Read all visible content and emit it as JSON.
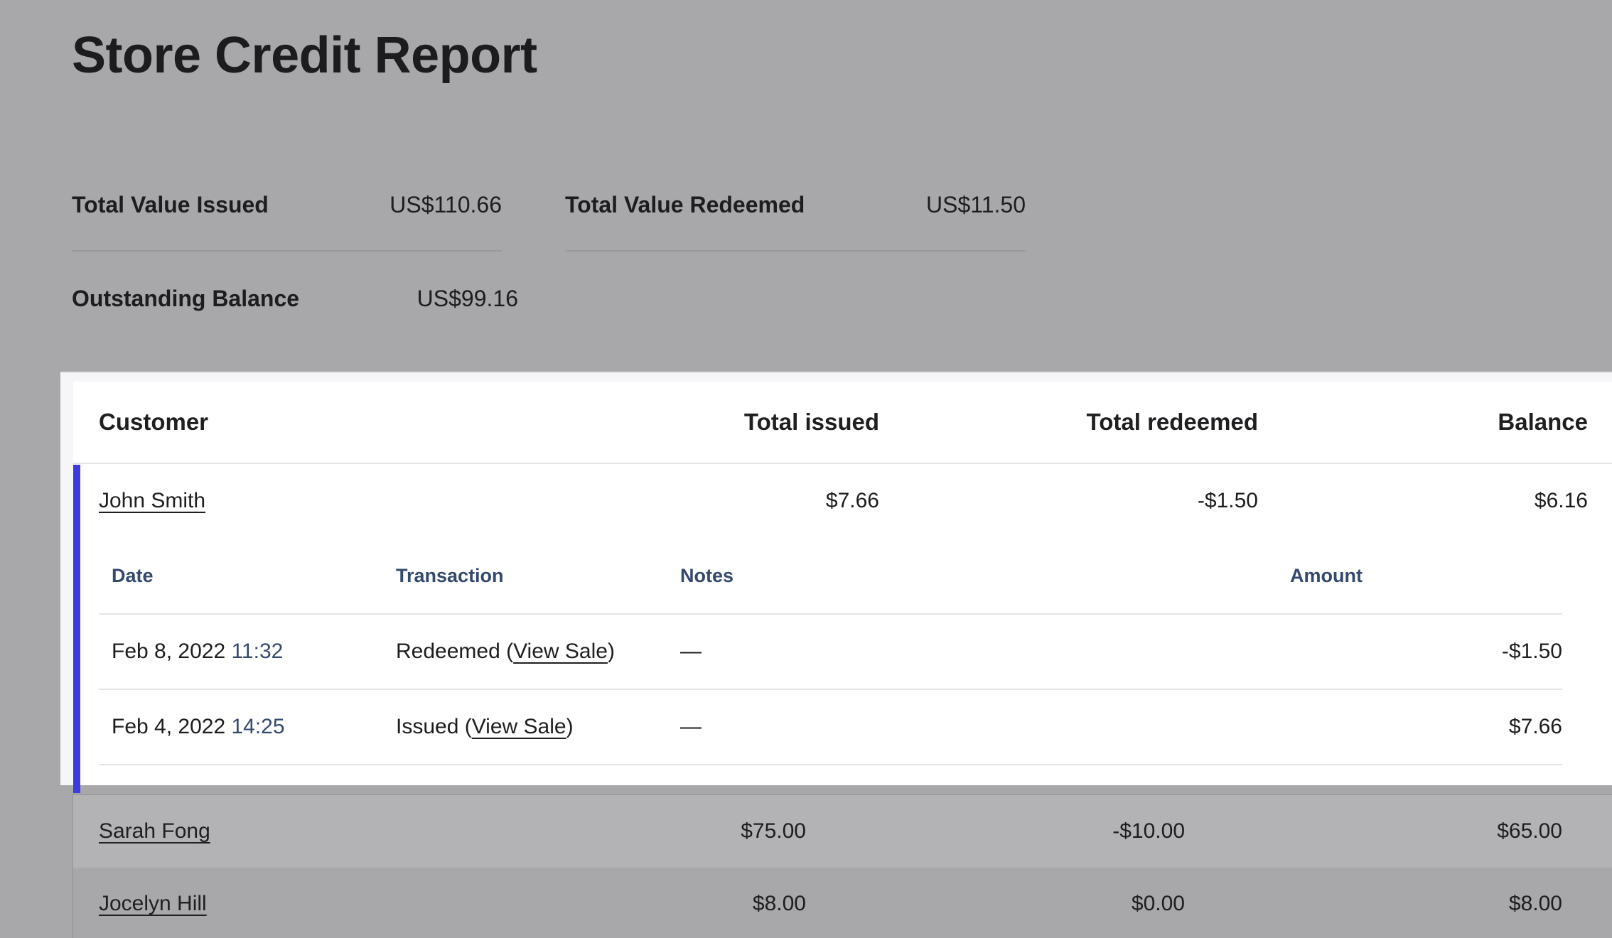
{
  "page": {
    "title": "Store Credit Report"
  },
  "summary": {
    "total_issued_label": "Total Value Issued",
    "total_issued_value": "US$110.66",
    "total_redeemed_label": "Total Value Redeemed",
    "total_redeemed_value": "US$11.50",
    "outstanding_label": "Outstanding Balance",
    "outstanding_value": "US$99.16"
  },
  "table": {
    "columns": {
      "customer": "Customer",
      "total_issued": "Total issued",
      "total_redeemed": "Total redeemed",
      "balance": "Balance"
    },
    "rows": [
      {
        "customer": "John Smith",
        "total_issued": "$7.66",
        "total_redeemed": "-$1.50",
        "balance": "$6.16",
        "expanded": true
      },
      {
        "customer": "Sarah Fong",
        "total_issued": "$75.00",
        "total_redeemed": "-$10.00",
        "balance": "$65.00"
      },
      {
        "customer": "Jocelyn Hill",
        "total_issued": "$8.00",
        "total_redeemed": "$0.00",
        "balance": "$8.00"
      }
    ],
    "transactions": {
      "columns": {
        "date": "Date",
        "transaction": "Transaction",
        "notes": "Notes",
        "amount": "Amount"
      },
      "rows": [
        {
          "date": "Feb 8, 2022",
          "time": "11:32",
          "transaction": "Redeemed",
          "link": "View Sale",
          "notes": "—",
          "amount": "-$1.50"
        },
        {
          "date": "Feb 4, 2022",
          "time": "14:25",
          "transaction": "Issued",
          "link": "View Sale",
          "notes": "—",
          "amount": "$7.66"
        }
      ]
    }
  },
  "colors": {
    "background": "#a8a7aa",
    "accent": "#3b3bdf",
    "subheader": "#34496e",
    "row_highlight": "#b3b3b5"
  }
}
